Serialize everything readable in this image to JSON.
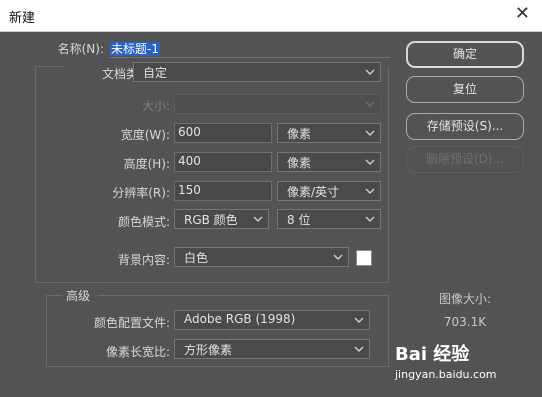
{
  "window": {
    "title": "新建",
    "close_glyph": "✕"
  },
  "name": {
    "label": "名称(N):",
    "value": "未标题-1"
  },
  "document_type": {
    "label": "文档类型:",
    "value": "自定"
  },
  "size": {
    "label": "大小:",
    "value": ""
  },
  "width": {
    "label": "宽度(W):",
    "value": "600",
    "unit": "像素"
  },
  "height": {
    "label": "高度(H):",
    "value": "400",
    "unit": "像素"
  },
  "resolution": {
    "label": "分辨率(R):",
    "value": "150",
    "unit": "像素/英寸"
  },
  "color_mode": {
    "label": "颜色模式:",
    "value": "RGB 颜色",
    "depth": "8 位"
  },
  "background": {
    "label": "背景内容:",
    "value": "白色",
    "swatch_color": "#ffffff"
  },
  "advanced": {
    "title": "高级",
    "color_profile_label": "颜色配置文件:",
    "color_profile_value": "Adobe RGB (1998)",
    "pixel_aspect_label": "像素长宽比:",
    "pixel_aspect_value": "方形像素"
  },
  "buttons": {
    "ok": "确定",
    "reset": "复位",
    "save_preset": "存储预设(S)...",
    "delete_preset": "删除预设(D)..."
  },
  "image_size": {
    "label": "图像大小:",
    "value": "703.1K"
  },
  "watermark": {
    "brand": "Bai 经验",
    "url": "jingyan.baidu.com"
  }
}
